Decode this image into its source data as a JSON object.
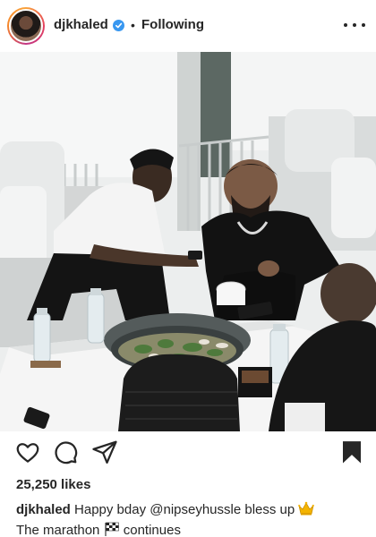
{
  "post": {
    "username": "djkhaled",
    "follow_status": "Following",
    "separator": "•",
    "verified": true,
    "likes_text": "25,250 likes",
    "caption": {
      "username": "djkhaled",
      "text_1": "Happy bday @nipseyhussle bless up",
      "emoji_1": "crown-emoji",
      "text_2": "The marathon",
      "emoji_2": "checkered-flag-emoji",
      "text_3": "continues"
    }
  },
  "icons": {
    "more": "more-options-icon",
    "like": "heart-icon",
    "comment": "comment-icon",
    "share": "send-icon",
    "save": "bookmark-icon"
  },
  "colors": {
    "text": "#262626",
    "verified_badge": "#3897f0",
    "save_icon": "#262626"
  }
}
